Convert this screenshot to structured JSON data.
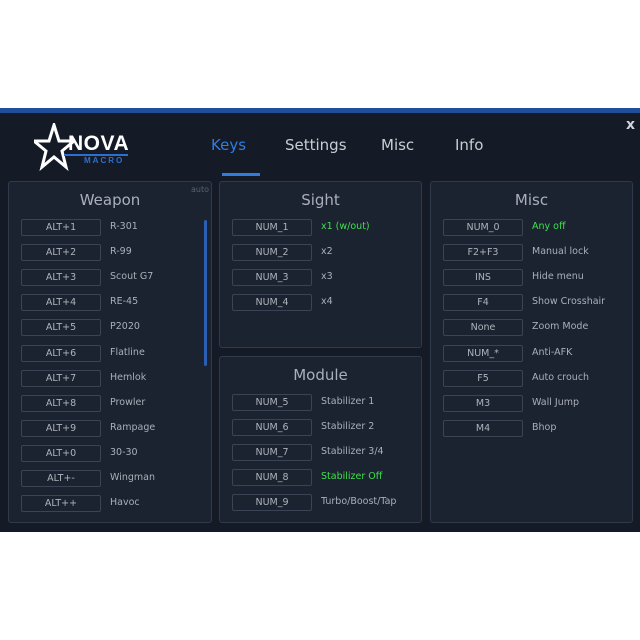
{
  "header": {
    "logo": {
      "name": "NOVA",
      "sub": "MACRO"
    },
    "tabs": [
      {
        "label": "Keys",
        "active": true
      },
      {
        "label": "Settings",
        "active": false
      },
      {
        "label": "Misc",
        "active": false
      },
      {
        "label": "Info",
        "active": false
      }
    ],
    "close_label": "x"
  },
  "weapon": {
    "title": "Weapon",
    "auto_label": "auto",
    "items": [
      {
        "key": "ALT+1",
        "label": "R-301"
      },
      {
        "key": "ALT+2",
        "label": "R-99"
      },
      {
        "key": "ALT+3",
        "label": "Scout G7"
      },
      {
        "key": "ALT+4",
        "label": "RE-45"
      },
      {
        "key": "ALT+5",
        "label": "P2020"
      },
      {
        "key": "ALT+6",
        "label": "Flatline"
      },
      {
        "key": "ALT+7",
        "label": "Hemlok"
      },
      {
        "key": "ALT+8",
        "label": "Prowler"
      },
      {
        "key": "ALT+9",
        "label": "Rampage"
      },
      {
        "key": "ALT+0",
        "label": "30-30"
      },
      {
        "key": "ALT+-",
        "label": "Wingman"
      },
      {
        "key": "ALT++",
        "label": "Havoc"
      }
    ]
  },
  "sight": {
    "title": "Sight",
    "items": [
      {
        "key": "NUM_1",
        "label": "x1 (w/out)",
        "highlight": true
      },
      {
        "key": "NUM_2",
        "label": "x2"
      },
      {
        "key": "NUM_3",
        "label": "x3"
      },
      {
        "key": "NUM_4",
        "label": "x4"
      }
    ]
  },
  "module": {
    "title": "Module",
    "items": [
      {
        "key": "NUM_5",
        "label": "Stabilizer 1"
      },
      {
        "key": "NUM_6",
        "label": "Stabilizer 2"
      },
      {
        "key": "NUM_7",
        "label": "Stabilizer 3/4"
      },
      {
        "key": "NUM_8",
        "label": "Stabilizer Off",
        "highlight": true
      },
      {
        "key": "NUM_9",
        "label": "Turbo/Boost/Tap"
      }
    ]
  },
  "misc": {
    "title": "Misc",
    "items": [
      {
        "key": "NUM_0",
        "label": "Any off",
        "highlight": true
      },
      {
        "key": "F2+F3",
        "label": "Manual lock"
      },
      {
        "key": "INS",
        "label": "Hide menu"
      },
      {
        "key": "F4",
        "label": "Show Crosshair"
      },
      {
        "key": "None",
        "label": "Zoom Mode"
      },
      {
        "key": "NUM_*",
        "label": "Anti-AFK"
      },
      {
        "key": "F5",
        "label": "Auto crouch"
      },
      {
        "key": "M3",
        "label": "Wall Jump"
      },
      {
        "key": "M4",
        "label": "Bhop"
      }
    ]
  },
  "colors": {
    "accent": "#2f7de0",
    "highlight": "#3fe04c",
    "background": "#151b26"
  }
}
